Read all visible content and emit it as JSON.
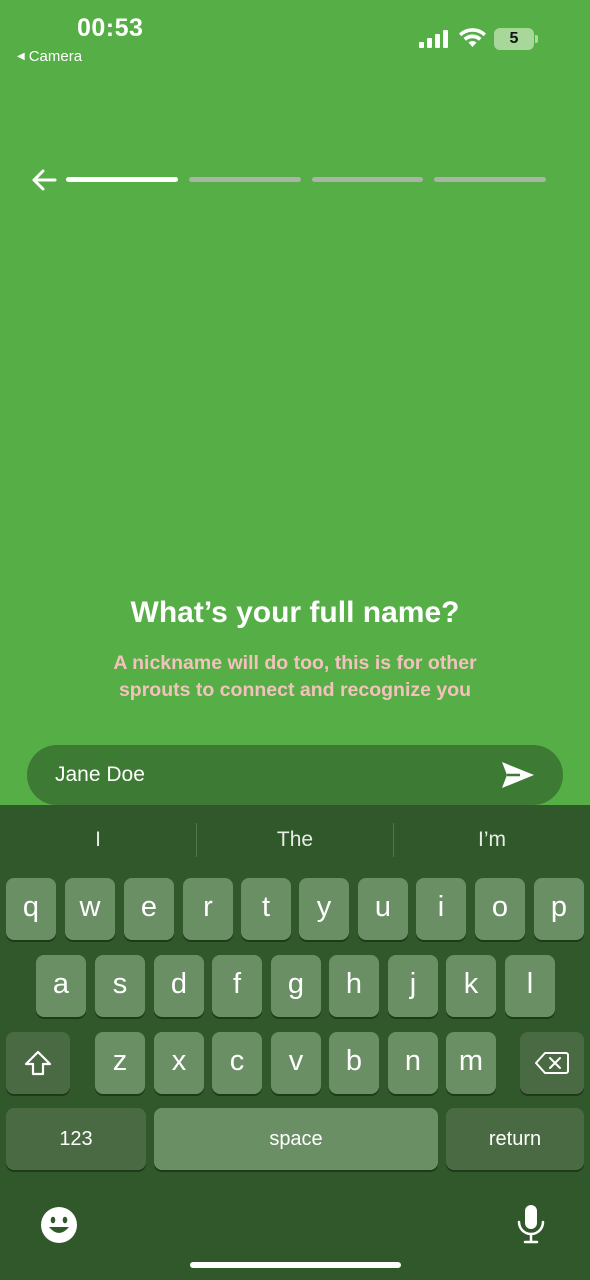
{
  "status_bar": {
    "time": "00:53",
    "back_app": "Camera",
    "battery_level": "5"
  },
  "progress": {
    "steps_total": 4,
    "current_step": 1
  },
  "question": {
    "title": "What’s your full name?",
    "subtitle": "A nickname will do too, this is for other sprouts to connect and recognize you"
  },
  "name_input": {
    "value": "Jane Doe"
  },
  "keyboard": {
    "suggestions": [
      "I",
      "The",
      "I’m"
    ],
    "row1": [
      "q",
      "w",
      "e",
      "r",
      "t",
      "y",
      "u",
      "i",
      "o",
      "p"
    ],
    "row2": [
      "a",
      "s",
      "d",
      "f",
      "g",
      "h",
      "j",
      "k",
      "l"
    ],
    "row3": [
      "z",
      "x",
      "c",
      "v",
      "b",
      "n",
      "m"
    ],
    "numbers_label": "123",
    "space_label": "space",
    "return_label": "return"
  },
  "colors": {
    "background": "#55ae46",
    "input_bg": "#3d7a33",
    "subtitle": "#f4c2bd",
    "keyboard_bg": "#30582a"
  }
}
